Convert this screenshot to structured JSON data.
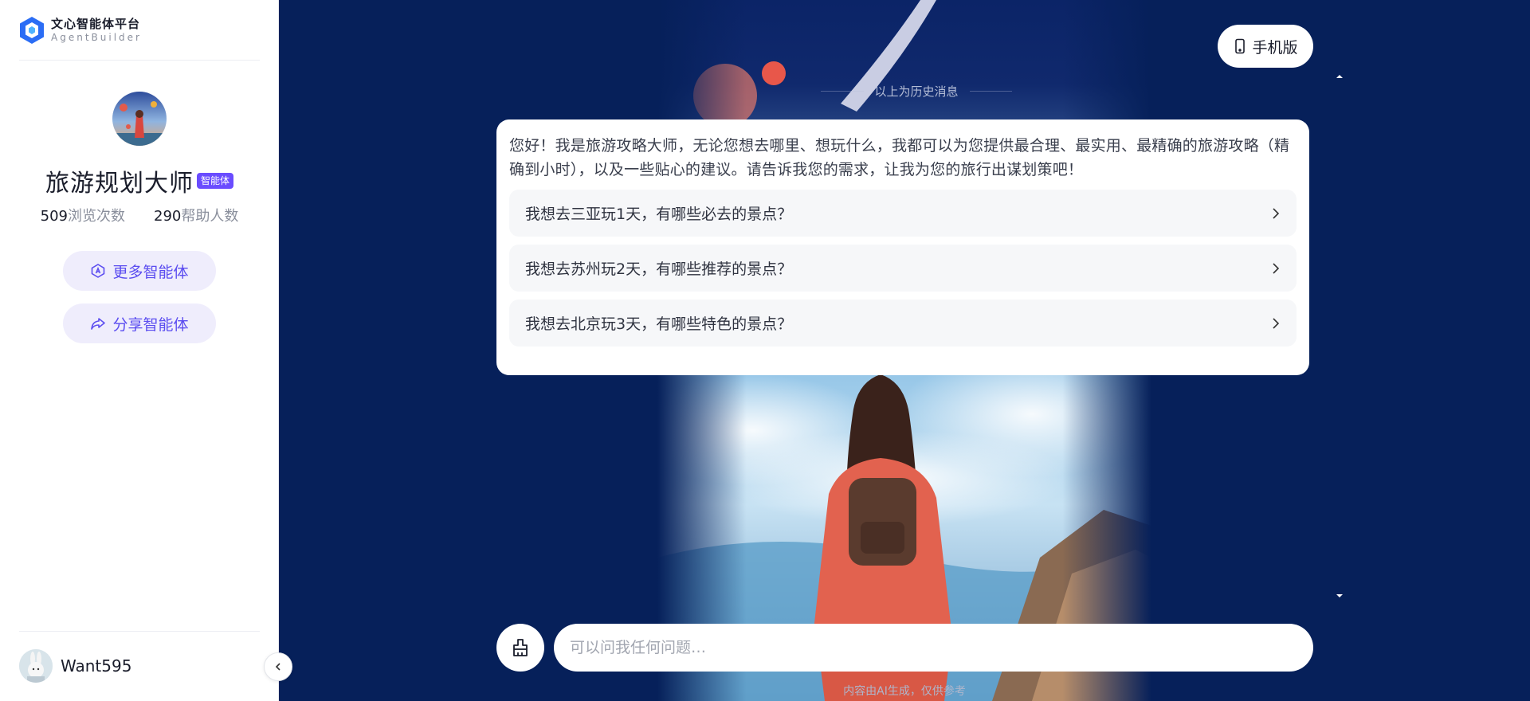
{
  "brand": {
    "name_cn": "文心智能体平台",
    "name_en": "AgentBuilder",
    "logo_icon": "agentbuilder-logo-icon"
  },
  "agent": {
    "name": "旅游规划大师",
    "tag": "智能体",
    "views_count": "509",
    "views_label": "浏览次数",
    "helped_count": "290",
    "helped_label": "帮助人数"
  },
  "sidebar": {
    "more_agents_label": "更多智能体",
    "share_agent_label": "分享智能体"
  },
  "user": {
    "name": "Want595"
  },
  "header": {
    "mobile_label": "手机版"
  },
  "chat": {
    "history_divider": "以上为历史消息",
    "greeting": "您好！我是旅游攻略大师，无论您想去哪里、想玩什么，我都可以为您提供最合理、最实用、最精确的旅游攻略（精确到小时），以及一些贴心的建议。请告诉我您的需求，让我为您的旅行出谋划策吧！",
    "suggestions": [
      "我想去三亚玩1天，有哪些必去的景点？",
      "我想去苏州玩2天，有哪些推荐的景点？",
      "我想去北京玩3天，有哪些特色的景点？"
    ]
  },
  "input": {
    "placeholder": "可以问我任何问题…",
    "value": ""
  },
  "footer": {
    "note": "内容由AI生成，仅供参考"
  },
  "colors": {
    "accent": "#6a4cff",
    "pill_bg": "#efedfc",
    "pill_text": "#5b4df0",
    "main_bg": "#06205a"
  }
}
